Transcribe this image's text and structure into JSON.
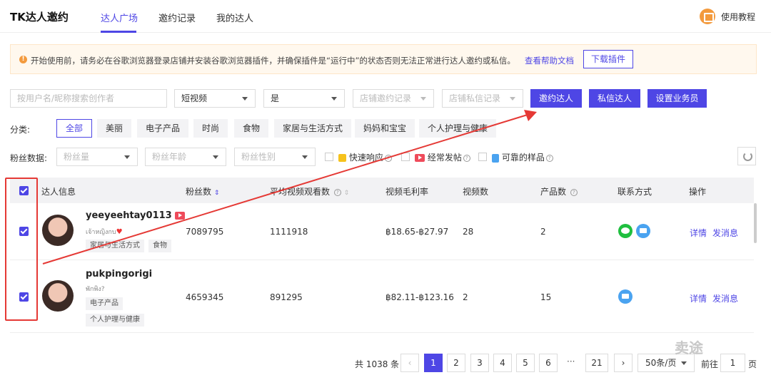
{
  "header": {
    "brand": "TK达人邀约",
    "tabs": [
      {
        "label": "达人广场"
      },
      {
        "label": "邀约记录"
      },
      {
        "label": "我的达人"
      }
    ],
    "help_label": "使用教程"
  },
  "notice": {
    "text": "开始使用前，请务必在谷歌浏览器登录店铺并安装谷歌浏览器插件，并确保插件是“运行中”的状态否则无法正常进行达人邀约或私信。",
    "link": "查看帮助文档",
    "button": "下载插件"
  },
  "filters": {
    "search_placeholder": "按用户名/昵称搜索创作者",
    "type_value": "短视频",
    "flag_value": "是",
    "store_invite_placeholder": "店铺邀约记录",
    "store_dm_placeholder": "店铺私信记录",
    "buttons": {
      "invite": "邀约达人",
      "dm": "私信达人",
      "set_salesperson": "设置业务员"
    }
  },
  "category": {
    "label": "分类:",
    "items": [
      "全部",
      "美丽",
      "电子产品",
      "时尚",
      "食物",
      "家居与生活方式",
      "妈妈和宝宝",
      "个人护理与健康"
    ]
  },
  "fans": {
    "label": "粉丝数据:",
    "fans_count_placeholder": "粉丝量",
    "fans_age_placeholder": "粉丝年龄",
    "fans_gender_placeholder": "粉丝性别",
    "checks": [
      "快速响应",
      "经常发帖",
      "可靠的样品"
    ]
  },
  "table": {
    "headers": [
      "达人信息",
      "粉丝数",
      "平均视频观看数",
      "视频毛利率",
      "视频数",
      "产品数",
      "联系方式",
      "操作"
    ],
    "rows": [
      {
        "username": "yeeyeehtay0113",
        "subtitle": "เจ้าหญิงกบ",
        "tags": [
          "家居与生活方式",
          "食物"
        ],
        "fans": "7089795",
        "avg_views": "1111918",
        "gross_margin": "฿18.65-฿27.97",
        "videos": "28",
        "products": "2",
        "actions": [
          "详情",
          "发消息"
        ]
      },
      {
        "username": "pukpingorigi",
        "subtitle": "พักพิง?",
        "tags": [
          "电子产品",
          "个人护理与健康"
        ],
        "fans": "4659345",
        "avg_views": "891295",
        "gross_margin": "฿82.11-฿123.16",
        "videos": "2",
        "products": "15",
        "actions": [
          "详情",
          "发消息"
        ]
      }
    ]
  },
  "pagination": {
    "total": "共 1038 条",
    "pages": [
      "1",
      "2",
      "3",
      "4",
      "5",
      "6",
      "21"
    ],
    "ellipsis": "···",
    "page_size": "50条/页",
    "goto_label": "前往",
    "goto_value": "1",
    "page_unit": "页"
  },
  "watermark": "卖途",
  "colors": {
    "accent": "#4e46e5",
    "annotation": "#e53935"
  }
}
